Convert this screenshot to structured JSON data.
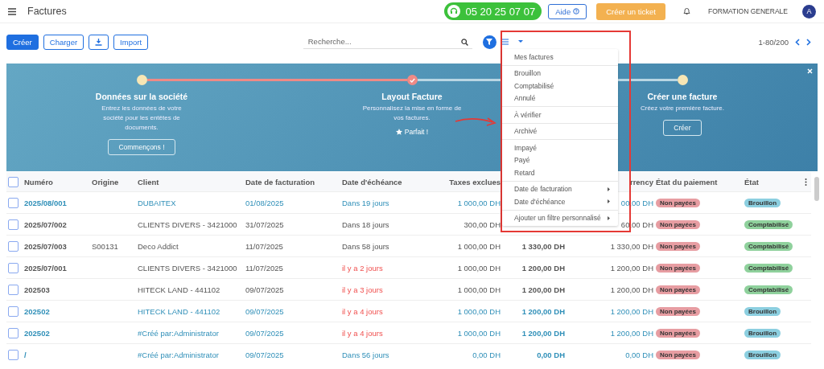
{
  "header": {
    "title": "Factures",
    "phone": "05 20 25 07 07",
    "help_button": "Aide",
    "ticket_button": "Créer un ticket",
    "company": "FORMATION GENERALE",
    "avatar": "A"
  },
  "toolbar": {
    "buttons": [
      {
        "label": "Créer",
        "kind": "primary"
      },
      {
        "label": "Charger",
        "kind": "outline"
      },
      {
        "kind": "download"
      },
      {
        "label": "Import",
        "kind": "outline"
      }
    ],
    "search": {
      "placeholder": "Recherche..."
    },
    "filter_menu": {
      "open": true,
      "groups": [
        [
          {
            "label": "Mes factures",
            "has_submenu": false
          }
        ],
        [
          {
            "label": "Brouillon",
            "has_submenu": false
          },
          {
            "label": "Comptabilisé",
            "has_submenu": false
          },
          {
            "label": "Annulé",
            "has_submenu": false
          }
        ],
        [
          {
            "label": "À vérifier",
            "has_submenu": false
          }
        ],
        [
          {
            "label": "Archivé",
            "has_submenu": false
          }
        ],
        [
          {
            "label": "Impayé",
            "has_submenu": false
          },
          {
            "label": "Payé",
            "has_submenu": false
          },
          {
            "label": "Retard",
            "has_submenu": false
          }
        ],
        [
          {
            "label": "Date de facturation",
            "has_submenu": true
          },
          {
            "label": "Date d'échéance",
            "has_submenu": true
          }
        ],
        [
          {
            "label": "Ajouter un filtre personnalisé",
            "has_submenu": true
          }
        ]
      ]
    },
    "pager": "1-80/200"
  },
  "banner": {
    "steps": [
      {
        "title": "Données sur la société",
        "description": "Entrez les données de votre société pour les entêtes de documents.",
        "action": "Commençons !",
        "done": false
      },
      {
        "title": "Layout Facture",
        "description": "Personnalisez la mise en forme de vos factures.",
        "action": "Parfait !",
        "done": true
      },
      {
        "title": "Créer une facture",
        "description": "Créez votre première facture.",
        "action": "Créer",
        "done": false
      }
    ]
  },
  "table": {
    "all_checked": false,
    "columns": [
      "Numéro",
      "Origine",
      "Client",
      "Date de facturation",
      "Date d'échéance",
      "Taxes exclues",
      null,
      "rrency",
      "État du paiement",
      "État"
    ],
    "rows": [
      {
        "kind": "draft",
        "overdue": false,
        "checked": false,
        "number": "2025/08/001",
        "client": "DUBAITEX",
        "invoice_date": "01/08/2025",
        "due": "Dans 19 jours",
        "untaxed": "1 000,00 DH",
        "currency_total": "00,00 DH",
        "payment": {
          "label": "Non payées",
          "color": "#e79da2"
        },
        "state": {
          "label": "Brouillon",
          "color": "#8ccfe0"
        }
      },
      {
        "kind": "posted",
        "overdue": false,
        "checked": false,
        "number": "2025/07/002",
        "client": "CLIENTS DIVERS - 3421000",
        "invoice_date": "31/07/2025",
        "due": "Dans 18 jours",
        "untaxed": "300,00 DH",
        "currency_total": "60,00 DH",
        "payment": {
          "label": "Non payées",
          "color": "#e79da2"
        },
        "state": {
          "label": "Comptabilisé",
          "color": "#8fd19c"
        }
      },
      {
        "kind": "posted",
        "overdue": false,
        "checked": false,
        "number": "2025/07/003",
        "origin": "S00131",
        "client": "Deco Addict",
        "invoice_date": "11/07/2025",
        "due": "Dans 58 jours",
        "untaxed": "1 000,00 DH",
        "total": "1 330,00 DH",
        "currency_total": "1 330,00 DH",
        "payment": {
          "label": "Non payées",
          "color": "#e79da2"
        },
        "state": {
          "label": "Comptabilisé",
          "color": "#8fd19c"
        }
      },
      {
        "kind": "posted",
        "overdue": true,
        "checked": false,
        "number": "2025/07/001",
        "client": "CLIENTS DIVERS - 3421000",
        "invoice_date": "11/07/2025",
        "due": "il y a 2 jours",
        "untaxed": "1 000,00 DH",
        "total": "1 200,00 DH",
        "currency_total": "1 200,00 DH",
        "payment": {
          "label": "Non payées",
          "color": "#e79da2"
        },
        "state": {
          "label": "Comptabilisé",
          "color": "#8fd19c"
        }
      },
      {
        "kind": "posted",
        "overdue": true,
        "checked": false,
        "number": "202503",
        "client": "HITECK LAND - 441102",
        "invoice_date": "09/07/2025",
        "due": "il y a 3 jours",
        "untaxed": "1 000,00 DH",
        "total": "1 200,00 DH",
        "currency_total": "1 200,00 DH",
        "payment": {
          "label": "Non payées",
          "color": "#e79da2"
        },
        "state": {
          "label": "Comptabilisé",
          "color": "#8fd19c"
        }
      },
      {
        "kind": "draft",
        "overdue": true,
        "checked": false,
        "number": "202502",
        "client": "HITECK LAND - 441102",
        "invoice_date": "09/07/2025",
        "due": "il y a 4 jours",
        "untaxed": "1 000,00 DH",
        "total": "1 200,00 DH",
        "currency_total": "1 200,00 DH",
        "payment": {
          "label": "Non payées",
          "color": "#e79da2"
        },
        "state": {
          "label": "Brouillon",
          "color": "#8ccfe0"
        }
      },
      {
        "kind": "draft",
        "overdue": true,
        "checked": false,
        "number": "202502",
        "client": "#Créé par:Administrator",
        "invoice_date": "09/07/2025",
        "due": "il y a 4 jours",
        "untaxed": "1 000,00 DH",
        "total": "1 200,00 DH",
        "currency_total": "1 200,00 DH",
        "payment": {
          "label": "Non payées",
          "color": "#e79da2"
        },
        "state": {
          "label": "Brouillon",
          "color": "#8ccfe0"
        }
      },
      {
        "kind": "draft",
        "overdue": false,
        "checked": false,
        "number": "/",
        "client": "#Créé par:Administrator",
        "invoice_date": "09/07/2025",
        "due": "Dans 56 jours",
        "untaxed": "0,00 DH",
        "total": "0,00 DH",
        "currency_total": "0,00 DH",
        "payment": {
          "label": "Non payées",
          "color": "#e79da2"
        },
        "state": {
          "label": "Brouillon",
          "color": "#8ccfe0"
        }
      }
    ]
  }
}
